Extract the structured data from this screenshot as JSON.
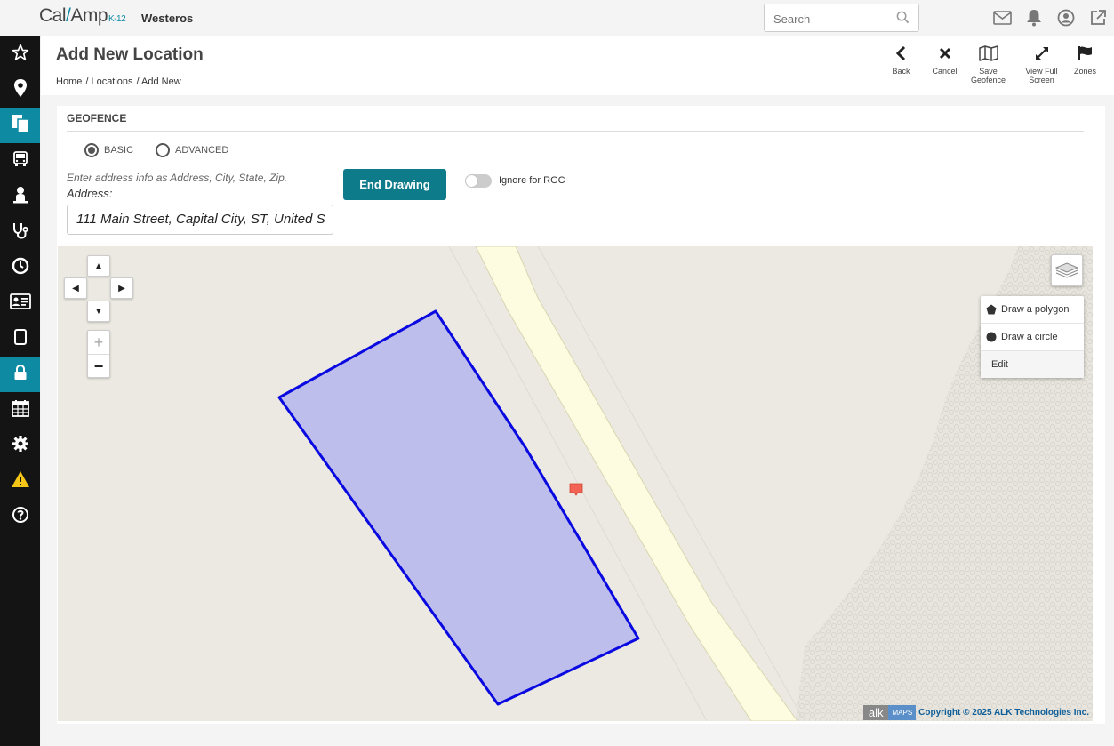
{
  "header": {
    "logo_main": "Cal",
    "logo_sep": "/",
    "logo_amp": "Amp",
    "logo_sub": "K-12",
    "org_name": "Westeros",
    "search_placeholder": "Search",
    "icons": [
      "mail-icon",
      "bell-icon",
      "user-icon",
      "external-link-icon"
    ]
  },
  "sidebar": {
    "items": [
      {
        "icon": "star-icon",
        "active": false
      },
      {
        "icon": "map-pin-icon",
        "active": false
      },
      {
        "icon": "documents-icon",
        "active": true
      },
      {
        "icon": "bus-icon",
        "active": false
      },
      {
        "icon": "student-icon",
        "active": false
      },
      {
        "icon": "stethoscope-icon",
        "active": false
      },
      {
        "icon": "clock-icon",
        "active": false
      },
      {
        "icon": "id-card-icon",
        "active": false
      },
      {
        "icon": "tablet-icon",
        "active": false
      },
      {
        "icon": "lock-icon",
        "active": true
      },
      {
        "icon": "calendar-icon",
        "active": false
      },
      {
        "icon": "gear-icon",
        "active": false
      },
      {
        "icon": "warning-icon",
        "active": false
      },
      {
        "icon": "help-icon",
        "active": false
      }
    ]
  },
  "page": {
    "title": "Add New Location",
    "breadcrumb": [
      "Home",
      "/ Locations",
      "/ Add New"
    ]
  },
  "actions": {
    "back": "Back",
    "cancel": "Cancel",
    "save_geofence": "Save Geofence",
    "view_full_screen": "View Full Screen",
    "zones": "Zones"
  },
  "geofence": {
    "section_title": "GEOFENCE",
    "mode_basic": "BASIC",
    "mode_advanced": "ADVANCED",
    "selected_mode": "BASIC",
    "hint": "Enter address info as Address, City, State, Zip.",
    "address_label": "Address:",
    "address_value": "111 Main Street, Capital City, ST, United S",
    "end_drawing_label": "End Drawing",
    "ignore_rgc_label": "Ignore for RGC",
    "ignore_rgc_on": false
  },
  "map": {
    "draw_polygon": "Draw a polygon",
    "draw_circle": "Draw a circle",
    "edit": "Edit",
    "attribution_alk": "alk",
    "attribution_maps": "MAPS",
    "copyright": "Copyright © 2025 ALK Technologies Inc.",
    "colors": {
      "polygon_fill": "#bebeec",
      "polygon_stroke": "#0a0ae0",
      "road": "#fdfce0",
      "land": "#ece9e2",
      "marker": "#f26355"
    }
  }
}
